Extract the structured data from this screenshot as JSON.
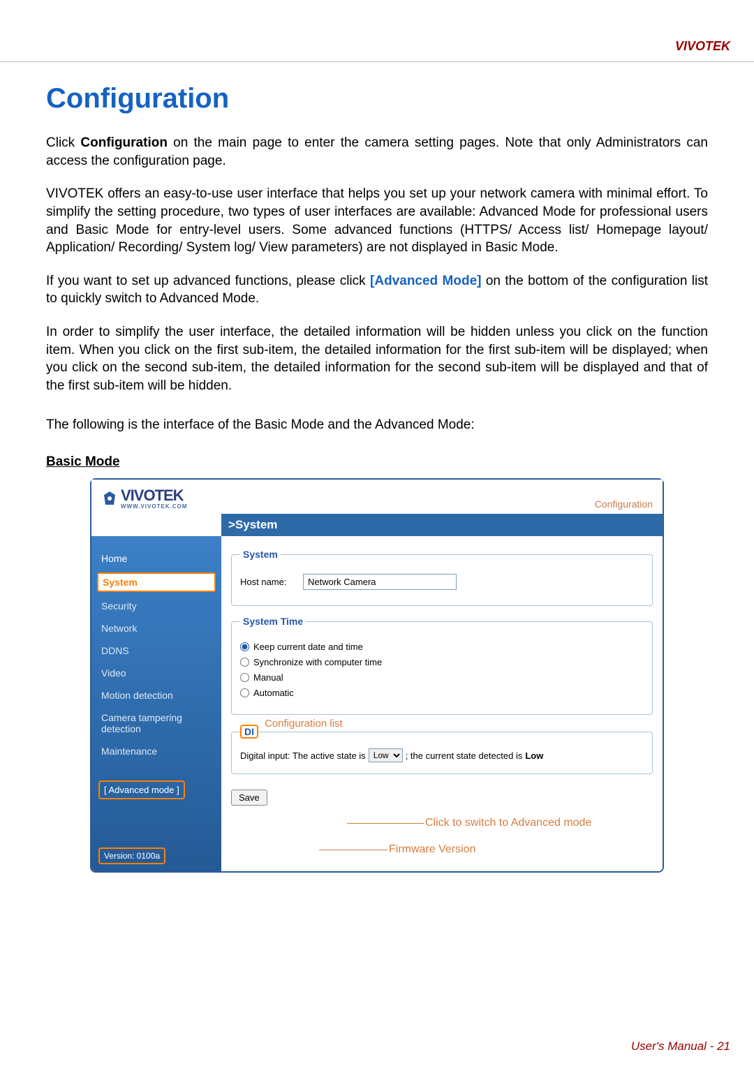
{
  "brand": "VIVOTEK",
  "title": "Configuration",
  "paragraphs": {
    "p1_a": "Click ",
    "p1_b": "Configuration",
    "p1_c": " on the main page to enter the camera setting pages. Note that only Administrators can access the configuration page.",
    "p2": "VIVOTEK offers an easy-to-use user interface that helps you set up your network camera with minimal effort. To simplify the setting procedure, two types of user interfaces are available: Advanced Mode for professional users and Basic Mode for entry-level users. Some advanced functions (HTTPS/ Access list/ Homepage layout/ Application/ Recording/ System log/ View parameters) are not displayed in Basic Mode.",
    "p3_a": "If you want to set up advanced functions, please click ",
    "p3_b": "[Advanced Mode]",
    "p3_c": " on the bottom of the configuration list to quickly switch to Advanced Mode.",
    "p4": "In order to simplify the user interface, the detailed information will be hidden unless you click on the function item. When you click on the first sub-item, the detailed information for the first sub-item will be displayed; when you click on the second sub-item, the detailed information for the second sub-item will be displayed and that of the first sub-item will be hidden.",
    "p5": "The following is the interface of the Basic Mode and the Advanced Mode:"
  },
  "basic_mode_label": "Basic Mode",
  "shot": {
    "logo": "VIVOTEK",
    "logo_sub": "WWW.VIVOTEK.COM",
    "config_link": "Configuration",
    "bluebar": ">System",
    "sidebar": {
      "home": "Home",
      "system": "System",
      "security": "Security",
      "network": "Network",
      "ddns": "DDNS",
      "video": "Video",
      "motion": "Motion detection",
      "tamper": "Camera tampering detection",
      "maint": "Maintenance",
      "adv_btn": "[ Advanced mode ]",
      "version": "Version: 0100a"
    },
    "system_group": {
      "legend": "System",
      "hostname_label": "Host name:",
      "hostname_value": "Network Camera"
    },
    "time_group": {
      "legend": "System Time",
      "opt_keep": "Keep current date and time",
      "opt_sync": "Synchronize with computer time",
      "opt_manual": "Manual",
      "opt_auto": "Automatic"
    },
    "di_group": {
      "legend": "DI",
      "config_list_label": "Configuration list",
      "text_a": "Digital input: The active state is",
      "select_value": "Low",
      "text_b": "; the current state detected is",
      "state_value": "Low"
    },
    "save_label": "Save",
    "callout_adv": "Click to switch to Advanced mode",
    "callout_fw": "Firmware Version"
  },
  "footer": {
    "label": "User's Manual - ",
    "page": "21"
  }
}
